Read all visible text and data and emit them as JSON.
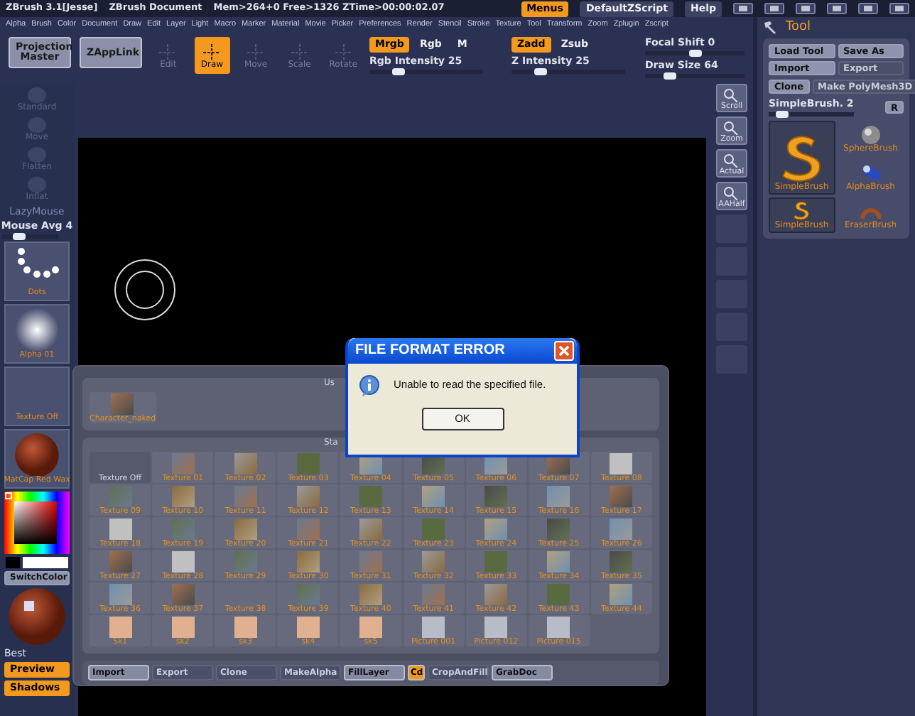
{
  "title_bar": {
    "app": "ZBrush 3.1[Jesse]",
    "document": "ZBrush Document",
    "stats": "Mem>264+0 Free>1326 ZTime>00:00:02.07",
    "buttons": [
      {
        "label": "Menus",
        "on": true
      },
      {
        "label": "DefaultZScript",
        "on": false
      },
      {
        "label": "Help",
        "on": false
      }
    ]
  },
  "menu": [
    "Alpha",
    "Brush",
    "Color",
    "Document",
    "Draw",
    "Edit",
    "Layer",
    "Light",
    "Macro",
    "Marker",
    "Material",
    "Movie",
    "Picker",
    "Preferences",
    "Render",
    "Stencil",
    "Stroke",
    "Texture",
    "Tool",
    "Transform",
    "Zoom",
    "Zplugin",
    "Zscript"
  ],
  "toolbar": {
    "big_buttons": [
      "Projection Master",
      "ZAppLink"
    ],
    "modes": [
      {
        "label": "Edit",
        "selected": false,
        "disabled": true
      },
      {
        "label": "Draw",
        "selected": true,
        "disabled": false
      },
      {
        "label": "Move",
        "selected": false,
        "disabled": true
      },
      {
        "label": "Scale",
        "selected": false,
        "disabled": true
      },
      {
        "label": "Rotate",
        "selected": false,
        "disabled": true
      }
    ],
    "rgb_toggles": [
      {
        "label": "Mrgb",
        "on": true
      },
      {
        "label": "Rgb",
        "on": false
      },
      {
        "label": "M",
        "on": false
      }
    ],
    "rgb_intensity": {
      "label": "Rgb Intensity 25",
      "level": 0.25
    },
    "z_toggles": [
      {
        "label": "Zadd",
        "on": true
      },
      {
        "label": "Zsub",
        "on": false
      }
    ],
    "z_intensity": {
      "label": "Z Intensity 25",
      "level": 0.25
    },
    "focal_shift": {
      "label": "Focal Shift 0",
      "level": 0.5
    },
    "draw_size": {
      "label": "Draw Size 64",
      "level": 0.25
    }
  },
  "left_panel": {
    "brushes": [
      {
        "label": "Standard",
        "disabled": true
      },
      {
        "label": "Move",
        "disabled": true
      },
      {
        "label": "Flatten",
        "disabled": true
      },
      {
        "label": "Inflat",
        "disabled": true
      }
    ],
    "lazymouse": "LazyMouse",
    "mouse_avg": {
      "label": "Mouse Avg 4",
      "level": 0.3
    },
    "tiles": [
      {
        "label": "Dots",
        "kind": "dots"
      },
      {
        "label": "Alpha 01",
        "kind": "alpha"
      },
      {
        "label": "Texture Off",
        "kind": "empty"
      },
      {
        "label": "MatCap Red Wax",
        "kind": "sphere"
      }
    ],
    "switch_color": "SwitchColor",
    "render_label": "Best",
    "render_buttons": [
      {
        "label": "Preview",
        "on": true
      },
      {
        "label": "Shadows",
        "on": true
      }
    ]
  },
  "view_buttons": [
    "Scroll",
    "Zoom",
    "Actual",
    "AAHalf"
  ],
  "tool_panel": {
    "title": "Tool",
    "buttons": [
      {
        "label": "Load Tool",
        "disabled": false
      },
      {
        "label": "Save As",
        "disabled": false
      },
      {
        "label": "Import",
        "disabled": false
      },
      {
        "label": "Export",
        "disabled": true
      },
      {
        "label": "Clone",
        "disabled": false
      },
      {
        "label": "Make PolyMesh3D",
        "disabled": true
      }
    ],
    "slider": {
      "label": "SimpleBrush. 2",
      "level": 0.15
    },
    "r_button": "R",
    "tools": [
      {
        "label": "SphereBrush",
        "kind": "sphere",
        "selected": false
      },
      {
        "label": "SimpleBrush",
        "kind": "s-big",
        "selected": true
      },
      {
        "label": "AlphaBrush",
        "kind": "capsule",
        "selected": false
      },
      {
        "label": "SimpleBrush",
        "kind": "s-small",
        "selected": true
      },
      {
        "label": "EraserBrush",
        "kind": "ring",
        "selected": false
      }
    ]
  },
  "texture_popup": {
    "used_header": "Us",
    "used": [
      {
        "label": "Character_naked",
        "kind": "texture"
      }
    ],
    "standard_header": "Sta",
    "textures": [
      {
        "label": "Texture Off",
        "kind": "none",
        "disabled": true
      },
      {
        "label": "Texture 01",
        "kind": "texture",
        "disabled": false
      },
      {
        "label": "Texture 02",
        "kind": "texture",
        "disabled": false
      },
      {
        "label": "Texture 03",
        "kind": "texture",
        "disabled": false
      },
      {
        "label": "Texture 04",
        "kind": "texture",
        "disabled": false
      },
      {
        "label": "Texture 05",
        "kind": "texture",
        "disabled": false
      },
      {
        "label": "Texture 06",
        "kind": "texture",
        "disabled": false
      },
      {
        "label": "Texture 07",
        "kind": "texture",
        "disabled": false
      },
      {
        "label": "Texture 08",
        "kind": "texture",
        "disabled": false
      },
      {
        "label": "Texture 09",
        "kind": "texture",
        "disabled": false
      },
      {
        "label": "Texture 10",
        "kind": "texture",
        "disabled": false
      },
      {
        "label": "Texture 11",
        "kind": "texture",
        "disabled": false
      },
      {
        "label": "Texture 12",
        "kind": "texture",
        "disabled": false
      },
      {
        "label": "Texture 13",
        "kind": "texture",
        "disabled": false
      },
      {
        "label": "Texture 14",
        "kind": "texture",
        "disabled": false
      },
      {
        "label": "Texture 15",
        "kind": "texture",
        "disabled": false
      },
      {
        "label": "Texture 16",
        "kind": "texture",
        "disabled": false
      },
      {
        "label": "Texture 17",
        "kind": "texture",
        "disabled": false
      },
      {
        "label": "Texture 18",
        "kind": "texture",
        "disabled": false
      },
      {
        "label": "Texture 19",
        "kind": "texture",
        "disabled": false
      },
      {
        "label": "Texture 20",
        "kind": "texture",
        "disabled": false
      },
      {
        "label": "Texture 21",
        "kind": "texture",
        "disabled": false
      },
      {
        "label": "Texture 22",
        "kind": "texture",
        "disabled": false
      },
      {
        "label": "Texture 23",
        "kind": "texture",
        "disabled": false
      },
      {
        "label": "Texture 24",
        "kind": "texture",
        "disabled": false
      },
      {
        "label": "Texture 25",
        "kind": "texture",
        "disabled": false
      },
      {
        "label": "Texture 26",
        "kind": "texture",
        "disabled": false
      },
      {
        "label": "Texture 27",
        "kind": "texture",
        "disabled": false
      },
      {
        "label": "Texture 28",
        "kind": "texture",
        "disabled": false
      },
      {
        "label": "Texture 29",
        "kind": "texture",
        "disabled": false
      },
      {
        "label": "Texture 30",
        "kind": "texture",
        "disabled": false
      },
      {
        "label": "Texture 31",
        "kind": "texture",
        "disabled": false
      },
      {
        "label": "Texture 32",
        "kind": "texture",
        "disabled": false
      },
      {
        "label": "Texture 33",
        "kind": "texture",
        "disabled": false
      },
      {
        "label": "Texture 34",
        "kind": "texture",
        "disabled": false
      },
      {
        "label": "Texture 35",
        "kind": "texture",
        "disabled": false
      },
      {
        "label": "Texture 36",
        "kind": "texture",
        "disabled": false
      },
      {
        "label": "Texture 37",
        "kind": "texture",
        "disabled": false
      },
      {
        "label": "Texture 38",
        "kind": "none",
        "disabled": false
      },
      {
        "label": "Texture 39",
        "kind": "texture",
        "disabled": false
      },
      {
        "label": "Texture 40",
        "kind": "texture",
        "disabled": false
      },
      {
        "label": "Texture 41",
        "kind": "texture",
        "disabled": false
      },
      {
        "label": "Texture 42",
        "kind": "texture",
        "disabled": false
      },
      {
        "label": "Texture 43",
        "kind": "texture",
        "disabled": false
      },
      {
        "label": "Texture 44",
        "kind": "texture",
        "disabled": false
      },
      {
        "label": "Sk1",
        "kind": "skin",
        "disabled": false
      },
      {
        "label": "sk2",
        "kind": "skin",
        "disabled": false
      },
      {
        "label": "sk3",
        "kind": "skin",
        "disabled": false
      },
      {
        "label": "sk4",
        "kind": "skin",
        "disabled": false
      },
      {
        "label": "sk5",
        "kind": "skin",
        "disabled": false
      },
      {
        "label": "Picture 001",
        "kind": "photo",
        "disabled": false
      },
      {
        "label": "Picture 012",
        "kind": "photo",
        "disabled": false
      },
      {
        "label": "Picture 015",
        "kind": "photo",
        "disabled": false
      }
    ],
    "buttons": [
      {
        "label": "Import",
        "kind": "button",
        "disabled": false
      },
      {
        "label": "Export",
        "kind": "button",
        "disabled": true
      },
      {
        "label": "Clone",
        "kind": "button",
        "disabled": true
      },
      {
        "label": "MakeAlpha",
        "kind": "button",
        "disabled": true
      },
      {
        "label": "FillLayer",
        "kind": "button",
        "disabled": false
      },
      {
        "label": "Cd",
        "kind": "toggle",
        "disabled": false
      },
      {
        "label": "CropAndFill",
        "kind": "button",
        "disabled": true
      },
      {
        "label": "GrabDoc",
        "kind": "button",
        "disabled": false
      }
    ]
  },
  "dialog": {
    "title": "FILE FORMAT ERROR",
    "message": "Unable to read the specified file.",
    "button": "OK"
  }
}
